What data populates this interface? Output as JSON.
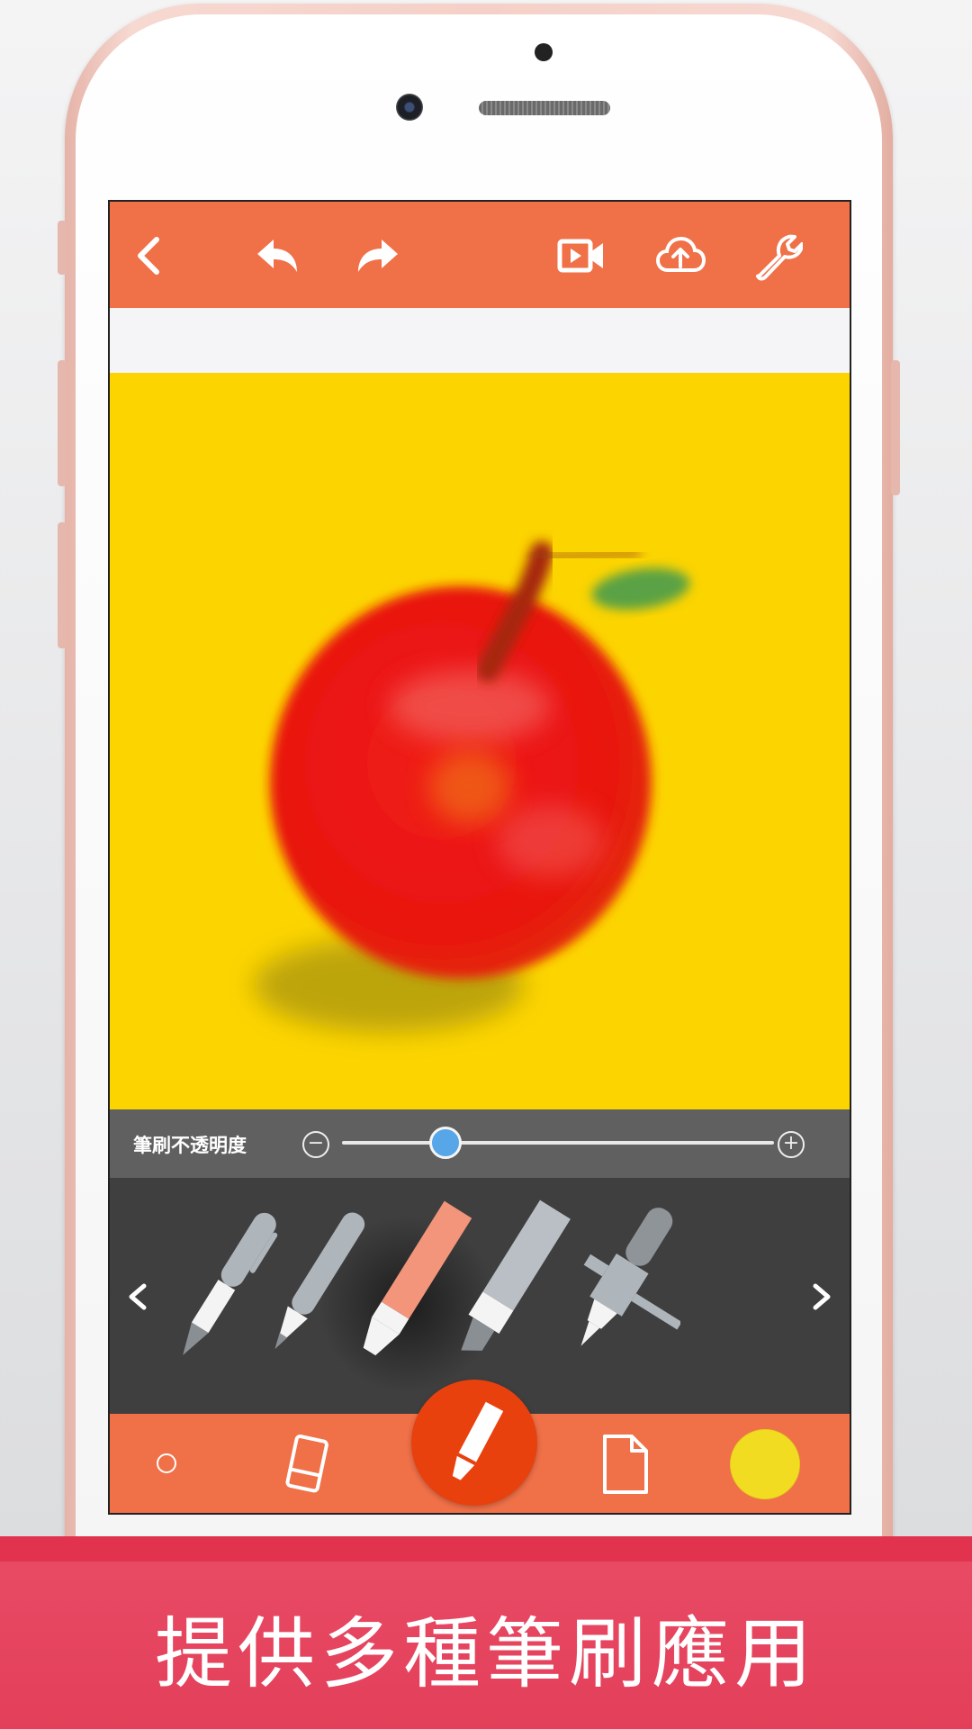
{
  "toolbar": {
    "back_icon": "chevron-left-icon",
    "undo_icon": "undo-icon",
    "redo_icon": "redo-icon",
    "video_icon": "video-icon",
    "upload_icon": "cloud-upload-icon",
    "settings_icon": "wrench-icon"
  },
  "opacity": {
    "label": "筆刷不透明度",
    "value": 0.24
  },
  "brushes": {
    "items": [
      "pen",
      "pencil",
      "crayon",
      "marker",
      "airbrush"
    ],
    "selected": "crayon",
    "selected_color": "#f3957a"
  },
  "bottom_bar": {
    "brush_size_icon": "brush-size-dot-icon",
    "eraser_icon": "eraser-icon",
    "active_tool_icon": "crayon-icon",
    "new_page_icon": "page-icon",
    "current_color": "#f2dc22"
  },
  "colors": {
    "accent": "#f07048",
    "fab": "#e8410e",
    "canvas": "#fcd400",
    "banner": "#e33f5a"
  },
  "banner": {
    "text": "提供多種筆刷應用"
  }
}
